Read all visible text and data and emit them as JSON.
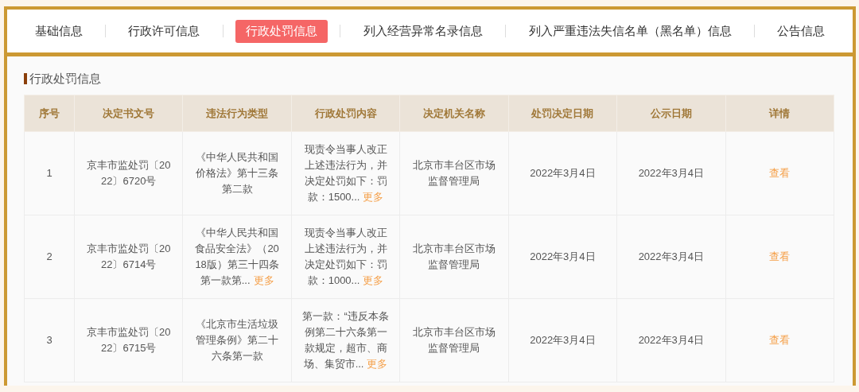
{
  "tabs": [
    {
      "label": "基础信息",
      "selected": false
    },
    {
      "label": "行政许可信息",
      "selected": false
    },
    {
      "label": "行政处罚信息",
      "selected": true
    },
    {
      "label": "列入经营异常名录信息",
      "selected": false
    },
    {
      "label": "列入严重违法失信名单（黑名单）信息",
      "selected": false
    },
    {
      "label": "公告信息",
      "selected": false
    }
  ],
  "section": {
    "title": "行政处罚信息"
  },
  "table": {
    "columns": [
      "序号",
      "决定书文号",
      "违法行为类型",
      "行政处罚内容",
      "决定机关名称",
      "处罚决定日期",
      "公示日期",
      "详情"
    ],
    "rows": [
      {
        "index": "1",
        "doc_no": "京丰市监处罚〔2022〕6720号",
        "violation": {
          "text": "《中华人民共和国价格法》第十三条第二款"
        },
        "content": {
          "text": "现责令当事人改正上述违法行为，并决定处罚如下：罚款：1500...",
          "more": "更多"
        },
        "authority": "北京市丰台区市场监督管理局",
        "decision_date": "2022年3月4日",
        "publish_date": "2022年3月4日",
        "detail": "查看"
      },
      {
        "index": "2",
        "doc_no": "京丰市监处罚〔2022〕6714号",
        "violation": {
          "text": "《中华人民共和国食品安全法》（2018版）第三十四条第一款第...",
          "more": "更多"
        },
        "content": {
          "text": "现责令当事人改正上述违法行为，并决定处罚如下：罚款：1000...",
          "more": "更多"
        },
        "authority": "北京市丰台区市场监督管理局",
        "decision_date": "2022年3月4日",
        "publish_date": "2022年3月4日",
        "detail": "查看"
      },
      {
        "index": "3",
        "doc_no": "京丰市监处罚〔2022〕6715号",
        "violation": {
          "text": "《北京市生活垃圾管理条例》第二十六条第一款"
        },
        "content": {
          "text": "第一款：“违反本条例第二十六条第一款规定，超市、商场、集贸市...",
          "more": "更多"
        },
        "authority": "北京市丰台区市场监督管理局",
        "decision_date": "2022年3月4日",
        "publish_date": "2022年3月4日",
        "detail": "查看"
      }
    ]
  }
}
